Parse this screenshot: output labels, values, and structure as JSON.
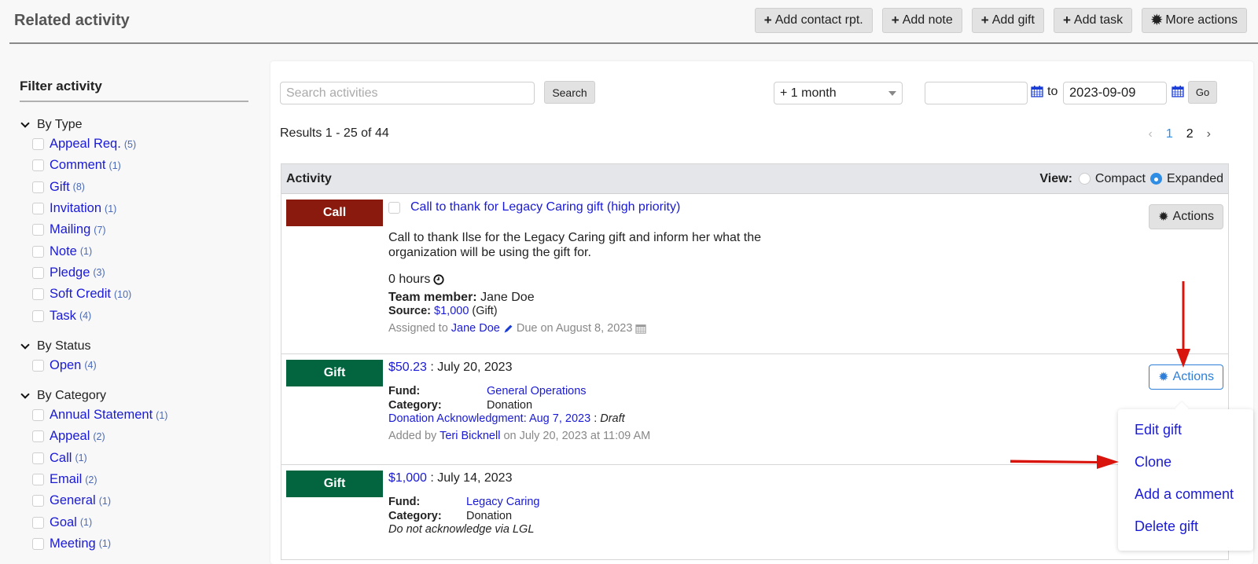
{
  "header": {
    "title": "Related activity",
    "buttons": [
      {
        "icon": "plus-icon",
        "label": "Add contact rpt."
      },
      {
        "icon": "plus-icon",
        "label": "Add note"
      },
      {
        "icon": "plus-icon",
        "label": "Add gift"
      },
      {
        "icon": "plus-icon",
        "label": "Add task"
      },
      {
        "icon": "gear-icon",
        "label": "More actions"
      }
    ]
  },
  "sidebar": {
    "title": "Filter activity",
    "groups": [
      {
        "label": "By Type",
        "items": [
          {
            "label": "Appeal Req.",
            "count": "(5)"
          },
          {
            "label": "Comment",
            "count": "(1)"
          },
          {
            "label": "Gift",
            "count": "(8)"
          },
          {
            "label": "Invitation",
            "count": "(1)"
          },
          {
            "label": "Mailing",
            "count": "(7)"
          },
          {
            "label": "Note",
            "count": "(1)"
          },
          {
            "label": "Pledge",
            "count": "(3)"
          },
          {
            "label": "Soft Credit",
            "count": "(10)"
          },
          {
            "label": "Task",
            "count": "(4)"
          }
        ]
      },
      {
        "label": "By Status",
        "items": [
          {
            "label": "Open",
            "count": "(4)"
          }
        ]
      },
      {
        "label": "By Category",
        "items": [
          {
            "label": "Annual Statement",
            "count": "(1)"
          },
          {
            "label": "Appeal",
            "count": "(2)"
          },
          {
            "label": "Call",
            "count": "(1)"
          },
          {
            "label": "Email",
            "count": "(2)"
          },
          {
            "label": "General",
            "count": "(1)"
          },
          {
            "label": "Goal",
            "count": "(1)"
          },
          {
            "label": "Meeting",
            "count": "(1)"
          }
        ]
      }
    ]
  },
  "toolbar": {
    "search_placeholder": "Search activities",
    "search_value": "",
    "search_label": "Search",
    "range_selected": "+ 1 month",
    "date_from": "",
    "to_label": "to",
    "date_to": "2023-09-09",
    "go_label": "Go"
  },
  "results": {
    "summary": "Results 1 - 25 of 44",
    "pages": [
      "1",
      "2"
    ],
    "current_page": "1",
    "prev": "‹",
    "next": "›"
  },
  "table": {
    "header": "Activity",
    "view_label": "View:",
    "view_options": [
      "Compact",
      "Expanded"
    ],
    "view_selected": "Expanded",
    "actions_label": "Actions",
    "rows": [
      {
        "type": "Call",
        "type_color": "#8b1a0e",
        "title": "Call to thank for Legacy Caring gift (high priority)",
        "description": "Call to thank Ilse for the Legacy Caring gift and inform her what the organization will be using the gift for.",
        "hours": "0 hours",
        "team_member_label": "Team member:",
        "team_member": "Jane Doe",
        "source_label": "Source:",
        "source_amount": "$1,000",
        "source_type": "(Gift)",
        "assigned_prefix": "Assigned to",
        "assigned_to": "Jane Doe",
        "due": "Due on August 8, 2023"
      },
      {
        "type": "Gift",
        "type_color": "#036440",
        "amount": "$50.23",
        "date": ": July 20, 2023",
        "fund_label": "Fund:",
        "fund": "General Operations",
        "category_label": "Category:",
        "category": "Donation",
        "ack_link": "Donation Acknowledgment: Aug 7, 2023",
        "ack_status": "Draft",
        "added_prefix": "Added by",
        "added_by": "Teri Bicknell",
        "added_suffix": "on July 20, 2023 at 11:09 AM"
      },
      {
        "type": "Gift",
        "type_color": "#036440",
        "amount": "$1,000",
        "date": ": July 14, 2023",
        "fund_label": "Fund:",
        "fund": "Legacy Caring",
        "category_label": "Category:",
        "category": "Donation",
        "note": "Do not acknowledge via LGL"
      }
    ]
  },
  "actions_menu": {
    "items": [
      "Edit gift",
      "Clone",
      "Add a comment",
      "Delete gift"
    ]
  },
  "colors": {
    "link": "#1a1ad6",
    "accent": "#2f8de4",
    "call_badge": "#8b1a0e",
    "gift_badge": "#036440",
    "annotation_arrow": "#d9140d"
  }
}
